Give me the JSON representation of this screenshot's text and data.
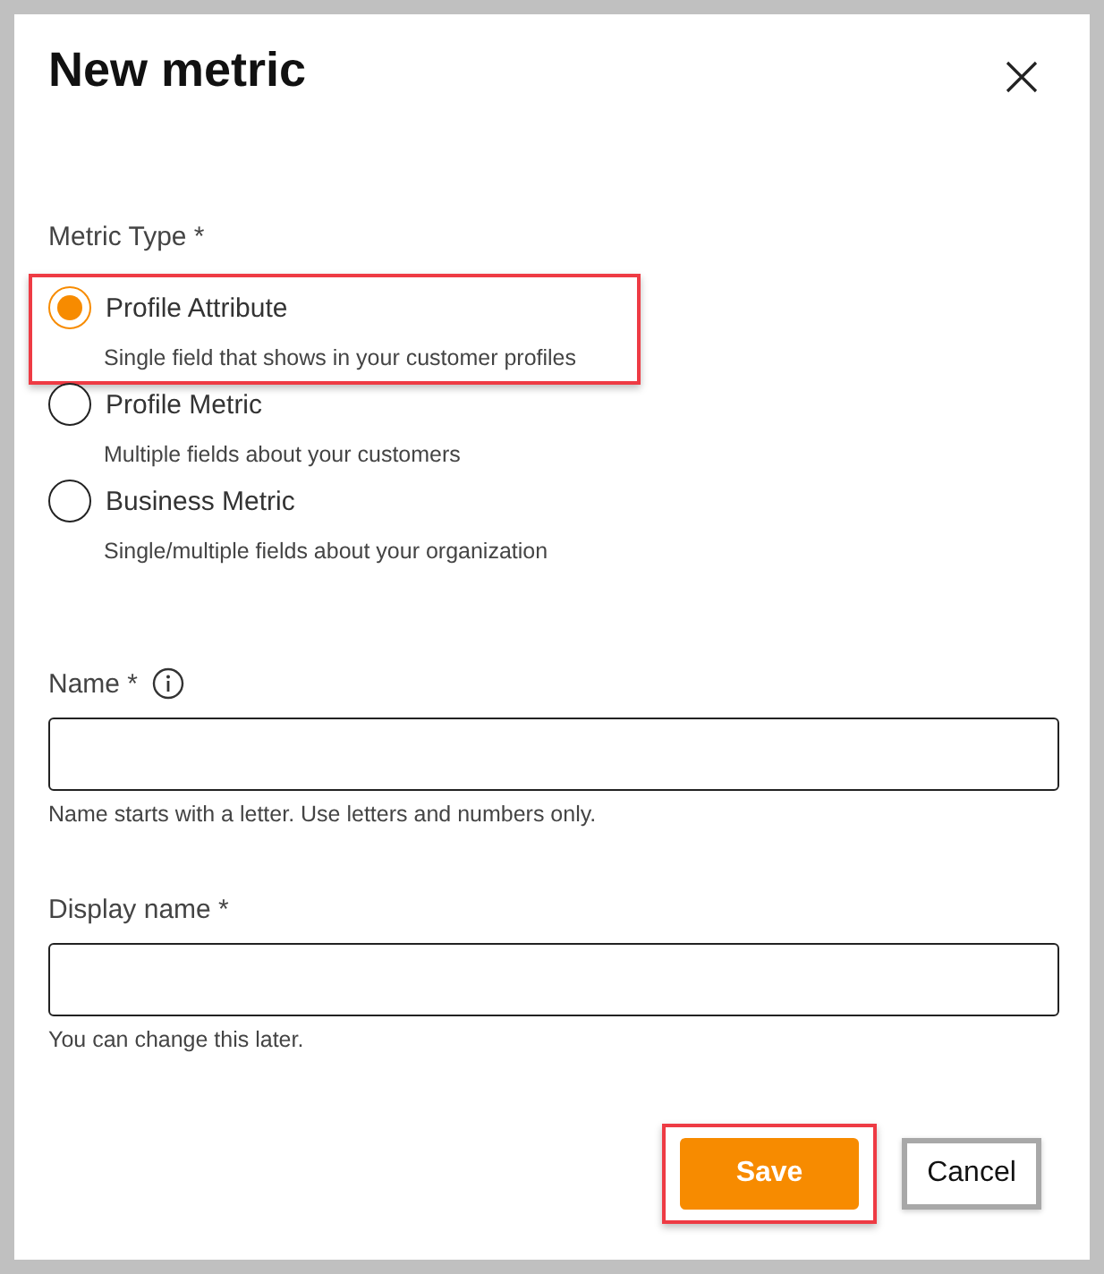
{
  "dialog": {
    "title": "New metric"
  },
  "metric_type": {
    "label": "Metric Type *",
    "options": [
      {
        "label": "Profile Attribute",
        "description": "Single field that shows in your customer profiles",
        "selected": true,
        "highlighted": true
      },
      {
        "label": "Profile Metric",
        "description": "Multiple fields about your customers",
        "selected": false,
        "highlighted": false
      },
      {
        "label": "Business Metric",
        "description": "Single/multiple fields about your organization",
        "selected": false,
        "highlighted": false
      }
    ]
  },
  "fields": [
    {
      "label": "Name *",
      "info": true,
      "hint": "Name starts with a letter. Use letters and numbers only."
    },
    {
      "label": "Display name *",
      "info": false,
      "hint": "You can change this later."
    }
  ],
  "buttons": [
    {
      "label": "Save",
      "kind": "primary",
      "highlighted": true
    },
    {
      "label": "Cancel",
      "kind": "secondary",
      "highlighted": false
    }
  ]
}
